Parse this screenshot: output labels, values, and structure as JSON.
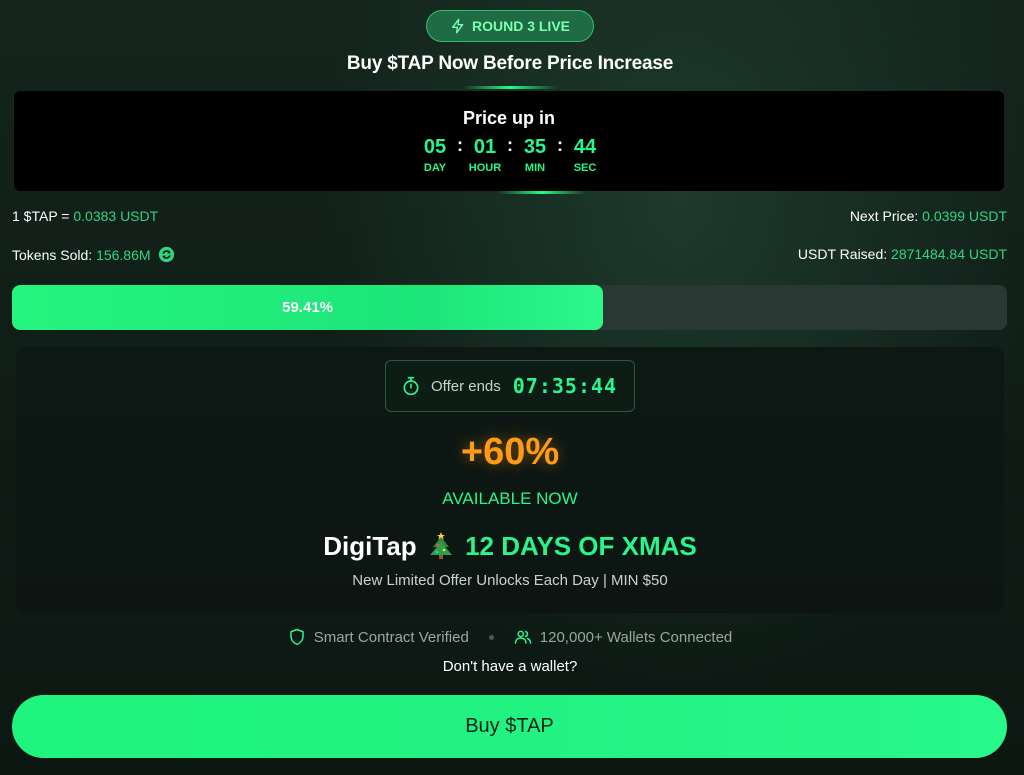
{
  "badge": {
    "label": "ROUND 3 LIVE",
    "icon": "lightning-icon"
  },
  "headline": "Buy $TAP Now Before Price Increase",
  "countdown": {
    "title": "Price up in",
    "units": [
      {
        "value": "05",
        "label": "DAY"
      },
      {
        "value": "01",
        "label": "HOUR"
      },
      {
        "value": "35",
        "label": "MIN"
      },
      {
        "value": "44",
        "label": "SEC"
      }
    ],
    "separator": ":"
  },
  "stats": {
    "price_label": "1 $TAP =",
    "price_value": "0.0383 USDT",
    "next_label": "Next Price:",
    "next_value": "0.0399 USDT",
    "sold_label": "Tokens Sold:",
    "sold_value": "156.86M",
    "raised_label": "USDT Raised:",
    "raised_value": "2871484.84 USDT"
  },
  "progress": {
    "percent": 59.41,
    "label": "59.41%"
  },
  "offer": {
    "ends_label": "Offer ends",
    "ends_time": "07:35:44",
    "bonus": "+60%",
    "availability": "AVAILABLE NOW",
    "brand": "DigiTap",
    "campaign": "12 DAYS OF XMAS",
    "subtitle": "New Limited Offer Unlocks Each Day | MIN $50"
  },
  "trust": {
    "verified": "Smart Contract Verified",
    "wallets": "120,000+ Wallets Connected"
  },
  "no_wallet": "Don't have a wallet?",
  "buy_button": "Buy $TAP",
  "colors": {
    "accent": "#28f58a",
    "bonus": "#ff9a17",
    "background": "#12211a"
  }
}
